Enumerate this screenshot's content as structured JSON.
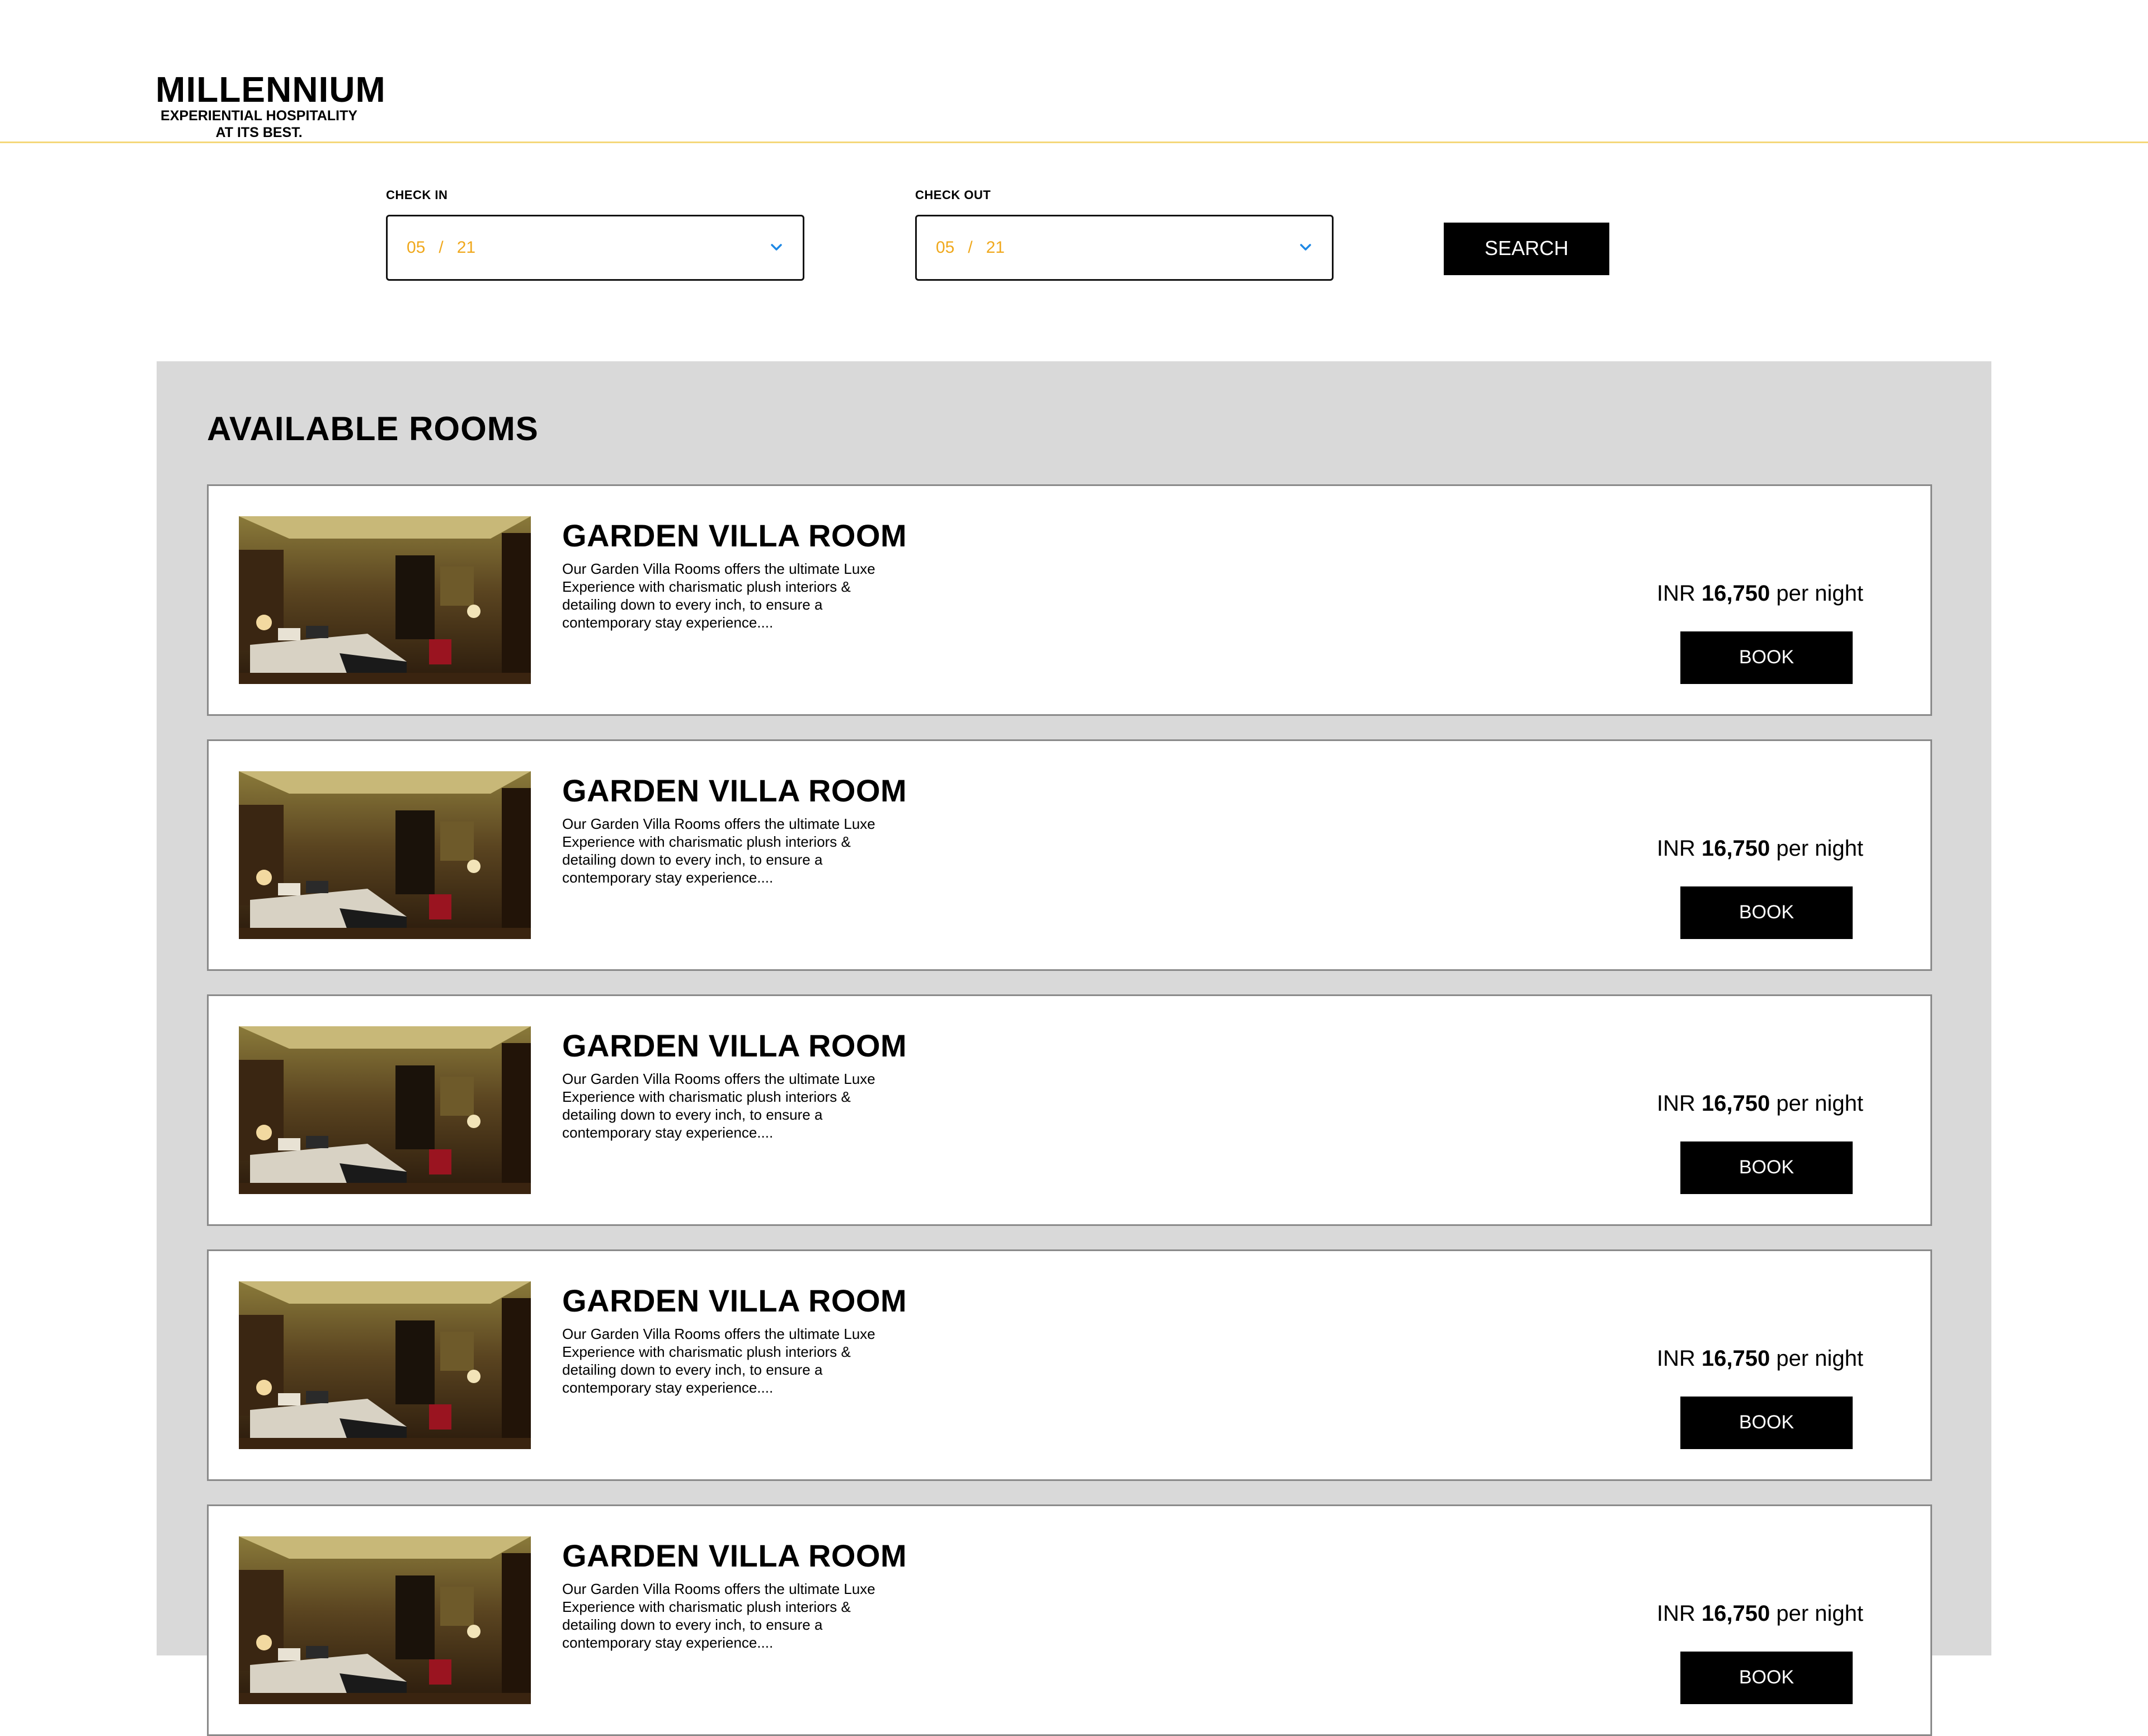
{
  "brand": {
    "name": "MILLENNIUM",
    "tagline_line1": "EXPERIENTIAL HOSPITALITY",
    "tagline_line2": "AT ITS BEST."
  },
  "booking": {
    "check_in": {
      "label": "CHECK IN",
      "month": "05",
      "separator": "/",
      "day": "21",
      "icon": "chevron-down-icon"
    },
    "check_out": {
      "label": "CHECK OUT",
      "month": "05",
      "separator": "/",
      "day": "21",
      "icon": "chevron-down-icon"
    },
    "search_label": "SEARCH"
  },
  "rooms": {
    "title": "AVAILABLE ROOMS",
    "items": [
      {
        "name": "GARDEN VILLA ROOM",
        "description": "Our Garden Villa Rooms offers the ultimate Luxe Experience with charismatic plush interiors & detailing down to every inch, to ensure a contemporary stay experience....",
        "currency": "INR",
        "price": "16,750",
        "unit": "per night",
        "book_label": "BOOK"
      },
      {
        "name": "GARDEN VILLA ROOM",
        "description": "Our Garden Villa Rooms offers the ultimate Luxe Experience with charismatic plush interiors & detailing down to every inch, to ensure a contemporary stay experience....",
        "currency": "INR",
        "price": "16,750",
        "unit": "per night",
        "book_label": "BOOK"
      },
      {
        "name": "GARDEN VILLA ROOM",
        "description": "Our Garden Villa Rooms offers the ultimate Luxe Experience with charismatic plush interiors & detailing down to every inch, to ensure a contemporary stay experience....",
        "currency": "INR",
        "price": "16,750",
        "unit": "per night",
        "book_label": "BOOK"
      },
      {
        "name": "GARDEN VILLA ROOM",
        "description": "Our Garden Villa Rooms offers the ultimate Luxe Experience with charismatic plush interiors & detailing down to every inch, to ensure a contemporary stay experience....",
        "currency": "INR",
        "price": "16,750",
        "unit": "per night",
        "book_label": "BOOK"
      },
      {
        "name": "GARDEN VILLA ROOM",
        "description": "Our Garden Villa Rooms offers the ultimate Luxe Experience with charismatic plush interiors & detailing down to every inch, to ensure a contemporary stay experience....",
        "currency": "INR",
        "price": "16,750",
        "unit": "per night",
        "book_label": "BOOK"
      }
    ]
  },
  "colors": {
    "accent_yellow": "#f5d87a",
    "date_text": "#f0a81c",
    "chevron_blue": "#1e88e5",
    "panel_bg": "#d9d9d9",
    "button_bg": "#000000"
  }
}
